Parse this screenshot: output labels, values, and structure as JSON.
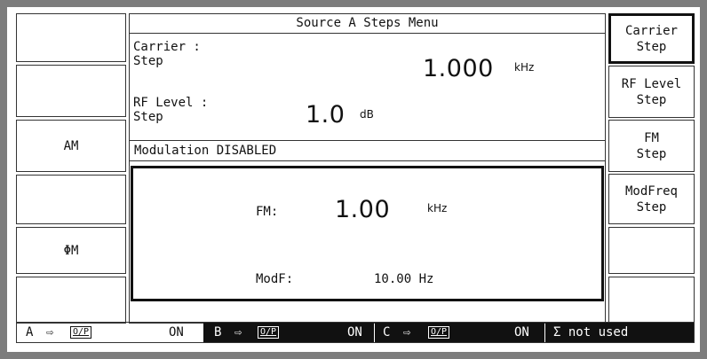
{
  "menu_title": "Source A Steps Menu",
  "left_softkeys": [
    "",
    "",
    "AM",
    "",
    "ΦM",
    ""
  ],
  "right_softkeys": [
    "Carrier\nStep",
    "RF Level\nStep",
    "FM\nStep",
    "ModFreq\nStep",
    "",
    ""
  ],
  "carrier": {
    "label": "Carrier :\nStep",
    "value": "1.000",
    "unit": "kHz"
  },
  "rf_level": {
    "label": "RF Level :\nStep",
    "value": "1.0",
    "unit": "dB"
  },
  "modulation_status": "Modulation DISABLED",
  "fm": {
    "label": "FM:",
    "value": "1.00",
    "unit": "kHz"
  },
  "modf": {
    "label": "ModF:",
    "value": "10.00 Hz"
  },
  "status_bar": [
    {
      "source": "A",
      "arrow": "⇨",
      "output": "O/P",
      "state": "ON"
    },
    {
      "source": "B",
      "arrow": "⇨",
      "output": "O/P",
      "state": "ON"
    },
    {
      "source": "C",
      "arrow": "⇨",
      "output": "O/P",
      "state": "ON"
    }
  ],
  "sigma": "Σ not used",
  "colors": {
    "frame": "#7d7d7d",
    "screen": "#ffffff",
    "ink": "#111111"
  }
}
